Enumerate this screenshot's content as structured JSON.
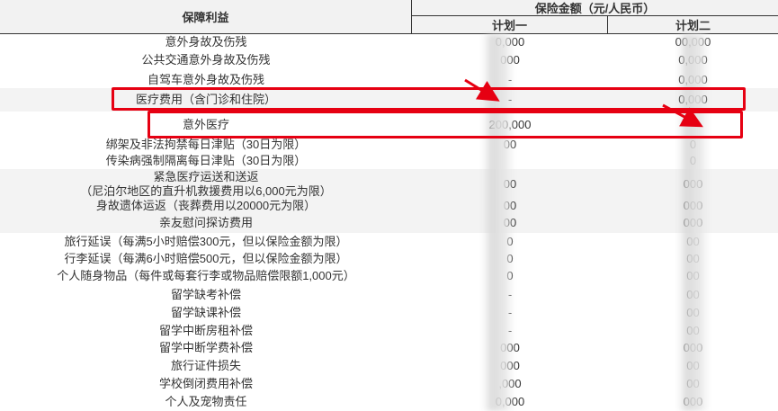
{
  "header": {
    "benefit": "保障利益",
    "amount": "保险金额（元/人民币）",
    "plan1": "计划一",
    "plan2": "计划二"
  },
  "rows": [
    {
      "benefit": "意外身故及伤残",
      "plan1": "0,000",
      "plan2": "00,000"
    },
    {
      "benefit": "公共交通意外身故及伤残",
      "plan1": "000",
      "plan2": "0,000"
    },
    {
      "benefit": "自驾车意外身故及伤残",
      "plan1": "-",
      "plan2": "0,000"
    },
    {
      "benefit": "医疗费用（含门诊和住院）",
      "plan1": "-",
      "plan2": "0,000"
    },
    {
      "benefit": "意外医疗",
      "plan1": "200,000",
      "plan2": "-"
    },
    {
      "benefit": "绑架及非法拘禁每日津贴（30日为限）",
      "plan1": "00",
      "plan2": "0"
    },
    {
      "benefit": "传染病强制隔离每日津贴（30日为限）",
      "plan1": "",
      "plan2": "0"
    },
    {
      "benefit": "紧急医疗运送和送返",
      "benefit2": "（尼泊尔地区的直升机救援费用以6,000元为限）",
      "plan1": "00",
      "plan2": "000"
    },
    {
      "benefit": "身故遗体运返（丧葬费用以20000元为限）",
      "plan1": "00",
      "plan2": "000"
    },
    {
      "benefit": "亲友慰问探访费用",
      "plan1": "00",
      "plan2": "000"
    },
    {
      "benefit": "旅行延误（每满5小时赔偿300元，但以保险金额为限）",
      "plan1": "0",
      "plan2": "00"
    },
    {
      "benefit": "行李延误（每满6小时赔偿500元，但以保险金额为限）",
      "plan1": "0",
      "plan2": "00"
    },
    {
      "benefit": "个人随身物品（每件或每套行李或物品赔偿限额1,000元）",
      "plan1": "0",
      "plan2": "00"
    },
    {
      "benefit": "留学缺考补偿",
      "plan1": "-",
      "plan2": "00"
    },
    {
      "benefit": "留学缺课补偿",
      "plan1": "-",
      "plan2": "00"
    },
    {
      "benefit": "留学中断房租补偿",
      "plan1": "-",
      "plan2": "00"
    },
    {
      "benefit": "留学中断学费补偿",
      "plan1": "000",
      "plan2": "000"
    },
    {
      "benefit": "旅行证件损失",
      "plan1": "000",
      "plan2": "00"
    },
    {
      "benefit": "学校倒闭费用补偿",
      "plan1": ",000",
      "plan2": "00"
    },
    {
      "benefit": "个人及宠物责任",
      "plan1": "0,000",
      "plan2": "000"
    }
  ],
  "colors": {
    "highlight": "#e60012",
    "shade": "#f3f3f3",
    "header_bg": "#f2f2f2"
  }
}
